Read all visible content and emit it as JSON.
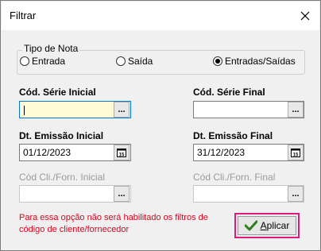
{
  "window": {
    "title": "Filtrar"
  },
  "tipo_nota": {
    "label": "Tipo de Nota",
    "options": [
      {
        "label": "Entrada",
        "checked": false
      },
      {
        "label": "Saída",
        "checked": false
      },
      {
        "label": "Entradas/Saídas",
        "checked": true
      }
    ]
  },
  "fields": {
    "serie_inicial": {
      "label": "Cód. Série Inicial",
      "value": ""
    },
    "serie_final": {
      "label": "Cód. Série Final",
      "value": ""
    },
    "emissao_inicial": {
      "label": "Dt. Emissão Inicial",
      "value": "01/12/2023"
    },
    "emissao_final": {
      "label": "Dt. Emissão Final",
      "value": "31/12/2023"
    },
    "cliforn_inicial": {
      "label": "Cód Cli./Forn. Inicial",
      "value": ""
    },
    "cliforn_final": {
      "label": "Cód Cli./Forn. Final",
      "value": ""
    }
  },
  "buttons": {
    "ellipsis": "...",
    "calendar_day": "15"
  },
  "warning": "Para essa opção não será habilitado os filtros de código de cliente/fornecedor",
  "apply": {
    "underlined": "A",
    "rest": "plicar"
  },
  "colors": {
    "warning": "#e0001a",
    "highlight_border": "#e0197d",
    "focus_border": "#0078d7"
  }
}
